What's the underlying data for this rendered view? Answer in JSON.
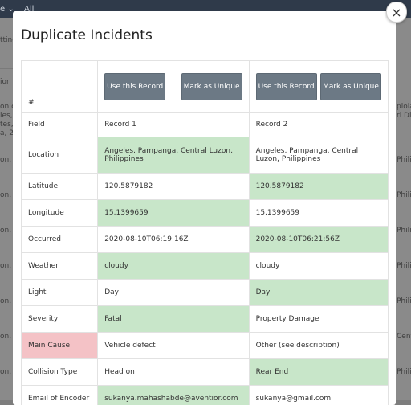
{
  "background": {
    "topbar_fragments": [
      "e ⌄",
      "All"
    ],
    "left_fragments": [
      "tting",
      "ion",
      "on c",
      "les, P",
      "tes, P",
      "a, 2,",
      "on, C",
      "on, C",
      "on, C",
      "on, C",
      "on, C",
      "on, C",
      "on, C",
      "on, C"
    ],
    "right_fragments": [
      "piola",
      "ri Dist",
      "Phili",
      "Phili",
      "Phili",
      "Phili",
      "Phili",
      "Phili",
      "Phili",
      "Cent",
      "Phili"
    ]
  },
  "modal": {
    "title": "Duplicate Incidents",
    "close_label": "×",
    "table": {
      "hash_label": "#",
      "record1_buttons": {
        "use": "Use this Record",
        "unique": "Mark as Unique"
      },
      "record2_buttons": {
        "use": "Use this Record",
        "unique": "Mark as Unique"
      },
      "header": {
        "field": "Field",
        "record1": "Record 1",
        "record2": "Record 2"
      },
      "rows": [
        {
          "label": "Location",
          "r1": "Angeles, Pampanga, Central Luzon, Philippines",
          "r2": "Angeles, Pampanga, Central Luzon, Philippines",
          "hl": "r1"
        },
        {
          "label": "Latitude",
          "r1": "120.5879182",
          "r2": "120.5879182",
          "hl": "r2"
        },
        {
          "label": "Longitude",
          "r1": "15.1399659",
          "r2": "15.1399659",
          "hl": "r1"
        },
        {
          "label": "Occurred",
          "r1": "2020-08-10T06:19:16Z",
          "r2": "2020-08-10T06:21:56Z",
          "hl": "r2"
        },
        {
          "label": "Weather",
          "r1": "cloudy",
          "r2": "cloudy",
          "hl": "r1"
        },
        {
          "label": "Light",
          "r1": "Day",
          "r2": "Day",
          "hl": "r2"
        },
        {
          "label": "Severity",
          "r1": "Fatal",
          "r2": "Property Damage",
          "hl": "r1"
        },
        {
          "label": "Main Cause",
          "r1": "Vehicle defect",
          "r2": "Other (see description)",
          "hl": "label"
        },
        {
          "label": "Collision Type",
          "r1": "Head on",
          "r2": "Rear End",
          "hl": "r2"
        },
        {
          "label": "Email of Encoder",
          "r1": "sukanya.mahashabde@aventior.com",
          "r2": "sukanya@gmail.com",
          "hl": "r1"
        }
      ]
    }
  },
  "colors": {
    "highlight": "#c8e6c9",
    "conflict": "#f4c2c6",
    "button": "#6c7985",
    "topbar": "#2f3a4a"
  }
}
